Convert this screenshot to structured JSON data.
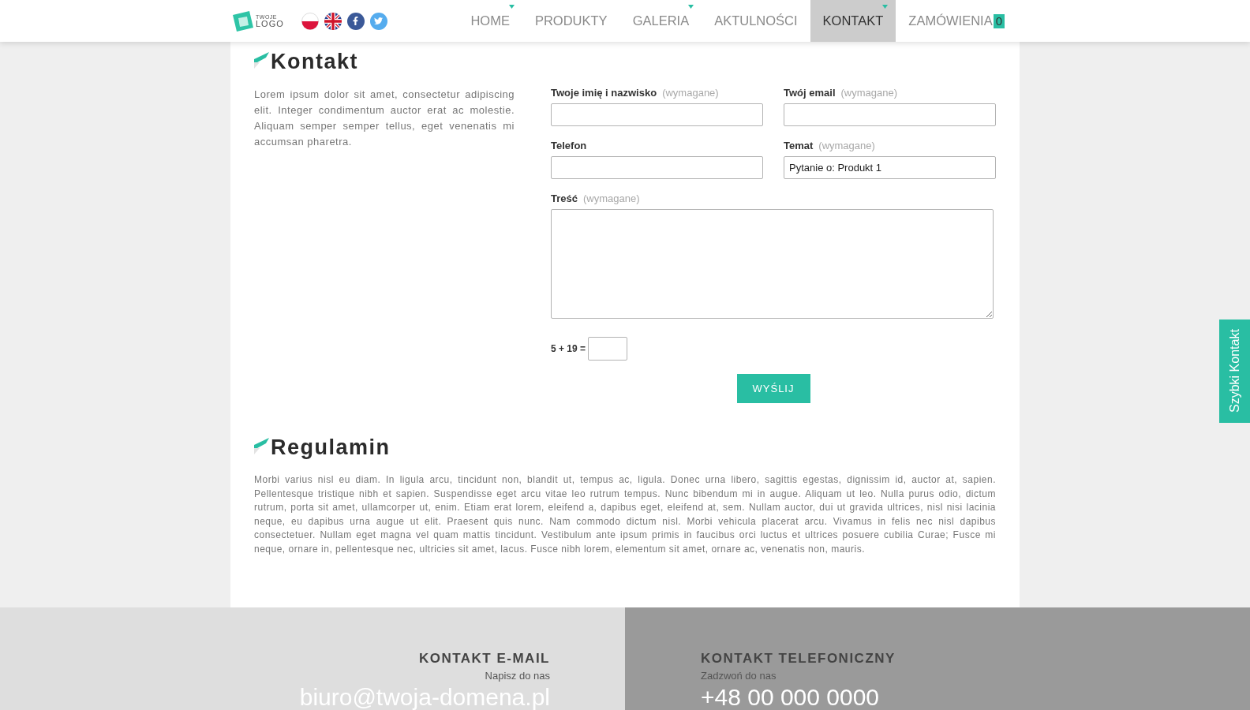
{
  "header": {
    "logo": {
      "line1": "TWOJE",
      "line2": "LOGO"
    },
    "nav": [
      {
        "label": "HOME",
        "selected": false,
        "has_submenu": true
      },
      {
        "label": "PRODUKTY",
        "selected": false,
        "has_submenu": false
      },
      {
        "label": "GALERIA",
        "selected": false,
        "has_submenu": true
      },
      {
        "label": "AKTULNOŚCI",
        "selected": false,
        "has_submenu": false
      },
      {
        "label": "KONTAKT",
        "selected": true,
        "has_submenu": true
      },
      {
        "label": "ZAMÓWIENIA",
        "selected": false,
        "has_submenu": false,
        "badge": "0"
      }
    ]
  },
  "contact": {
    "title": "Kontakt",
    "intro": "Lorem ipsum dolor sit amet, consectetur adipiscing elit. Integer condimentum auctor erat ac molestie. Aliquam semper semper tellus, eget venenatis mi accumsan pharetra.",
    "form": {
      "fields": [
        {
          "kind": "text",
          "label": "Twoje imię i nazwisko",
          "note": "(wymagane)"
        },
        {
          "kind": "text",
          "label": "Twój email",
          "note": "(wymagane)"
        },
        {
          "kind": "text",
          "label": "Telefon"
        },
        {
          "kind": "text",
          "label": "Temat",
          "note": "(wymagane)",
          "value": "Pytanie o: Produkt 1"
        },
        {
          "kind": "textarea",
          "label": "Treść",
          "note": "(wymagane)"
        }
      ],
      "captcha": {
        "question": "5 + 19 ="
      },
      "submit": "WYŚLIJ"
    }
  },
  "terms": {
    "title": "Regulamin",
    "text": "Morbi varius nisl eu diam. In ligula arcu, tincidunt non, blandit ut, tempus ac, ligula. Donec urna libero, sagittis egestas, dignissim id, auctor at, sapien. Pellentesque tristique nibh et sapien. Suspendisse eget arcu vitae leo rutrum tempus. Nunc bibendum mi in augue. Aliquam ut leo. Nulla purus odio, dictum rutrum, porta sit amet, ullamcorper ut, enim. Etiam erat lorem, eleifend a, dapibus eget, eleifend at, sem. Nullam auctor, dui ut gravida ultrices, nisl nisi lacinia neque, eu dapibus urna augue ut elit. Praesent quis nunc. Nam commodo dictum nisl. Morbi vehicula placerat arcu. Vivamus in felis nec nisl dapibus consectetuer. Nullam eget magna vel quam mattis tincidunt. Vestibulum ante ipsum primis in faucibus orci luctus et ultrices posuere cubilia Curae; Fusce mi neque, ornare in, pellentesque nec, ultricies sit amet, lacus. Fusce nibh lorem, elementum sit amet, ornare ac, venenatis non, mauris."
  },
  "footer": [
    {
      "title": "KONTAKT E-MAIL",
      "subtitle": "Napisz do nas",
      "value": "biuro@twoja-domena.pl"
    },
    {
      "title": "KONTAKT TELEFONICZNY",
      "subtitle": "Zadzwoń do nas",
      "value": "+48 00 000 0000"
    }
  ],
  "side_tab": {
    "label": "Szybki Kontakt"
  }
}
